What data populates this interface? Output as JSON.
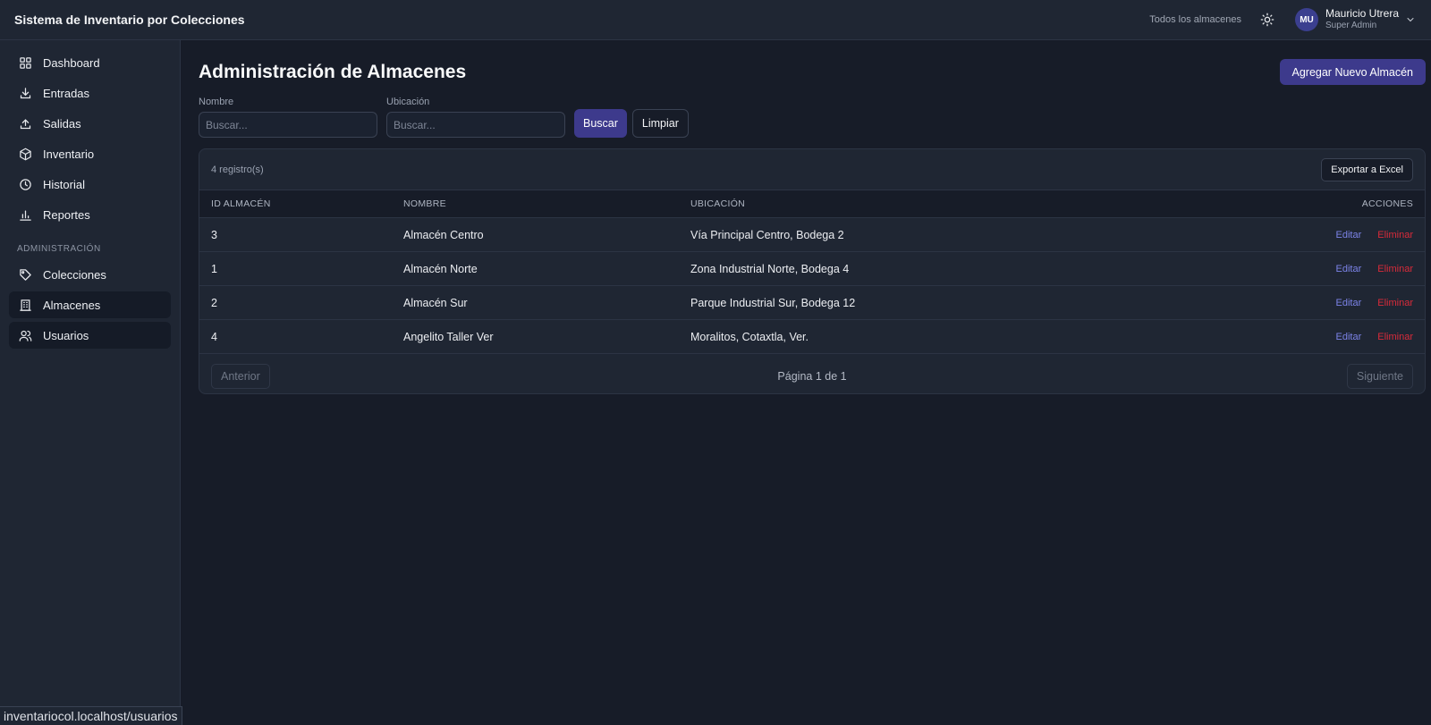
{
  "header": {
    "app_title": "Sistema de Inventario por Colecciones",
    "warehouse_selector": "Todos los almacenes",
    "theme_icon": "sun-icon",
    "user": {
      "initials": "MU",
      "name": "Mauricio Utrera",
      "role": "Super Admin"
    }
  },
  "sidebar": {
    "items": [
      {
        "label": "Dashboard",
        "icon": "grid-icon"
      },
      {
        "label": "Entradas",
        "icon": "download-icon"
      },
      {
        "label": "Salidas",
        "icon": "upload-icon"
      },
      {
        "label": "Inventario",
        "icon": "cube-icon"
      },
      {
        "label": "Historial",
        "icon": "clock-icon"
      },
      {
        "label": "Reportes",
        "icon": "bar-chart-icon"
      }
    ],
    "section_label": "ADMINISTRACIÓN",
    "admin_items": [
      {
        "label": "Colecciones",
        "icon": "tag-icon"
      },
      {
        "label": "Almacenes",
        "icon": "building-icon"
      },
      {
        "label": "Usuarios",
        "icon": "users-icon"
      }
    ]
  },
  "main": {
    "title": "Administración de Almacenes",
    "add_button": "Agregar Nuevo Almacén",
    "filters": {
      "name_label": "Nombre",
      "name_placeholder": "Buscar...",
      "location_label": "Ubicación",
      "location_placeholder": "Buscar...",
      "search_button": "Buscar",
      "clear_button": "Limpiar"
    },
    "table": {
      "record_count": "4 registro(s)",
      "export_button": "Exportar a Excel",
      "columns": [
        "ID ALMACÉN",
        "NOMBRE",
        "UBICACIÓN",
        "ACCIONES"
      ],
      "rows": [
        {
          "id": "3",
          "name": "Almacén Centro",
          "location": "Vía Principal Centro, Bodega 2"
        },
        {
          "id": "1",
          "name": "Almacén Norte",
          "location": "Zona Industrial Norte, Bodega 4"
        },
        {
          "id": "2",
          "name": "Almacén Sur",
          "location": "Parque Industrial Sur, Bodega 12"
        },
        {
          "id": "4",
          "name": "Angelito Taller Ver",
          "location": "Moralitos, Cotaxtla, Ver."
        }
      ],
      "edit_label": "Editar",
      "delete_label": "Eliminar",
      "pagination": {
        "prev": "Anterior",
        "info": "Página 1 de 1",
        "next": "Siguiente"
      }
    }
  },
  "status_bar_url": "inventariocol.localhost/usuarios",
  "colors": {
    "accent": "#3d3a8c",
    "background": "#171c28",
    "panel": "#1f2633",
    "danger": "#d92b3a",
    "link": "#7c83e8"
  }
}
